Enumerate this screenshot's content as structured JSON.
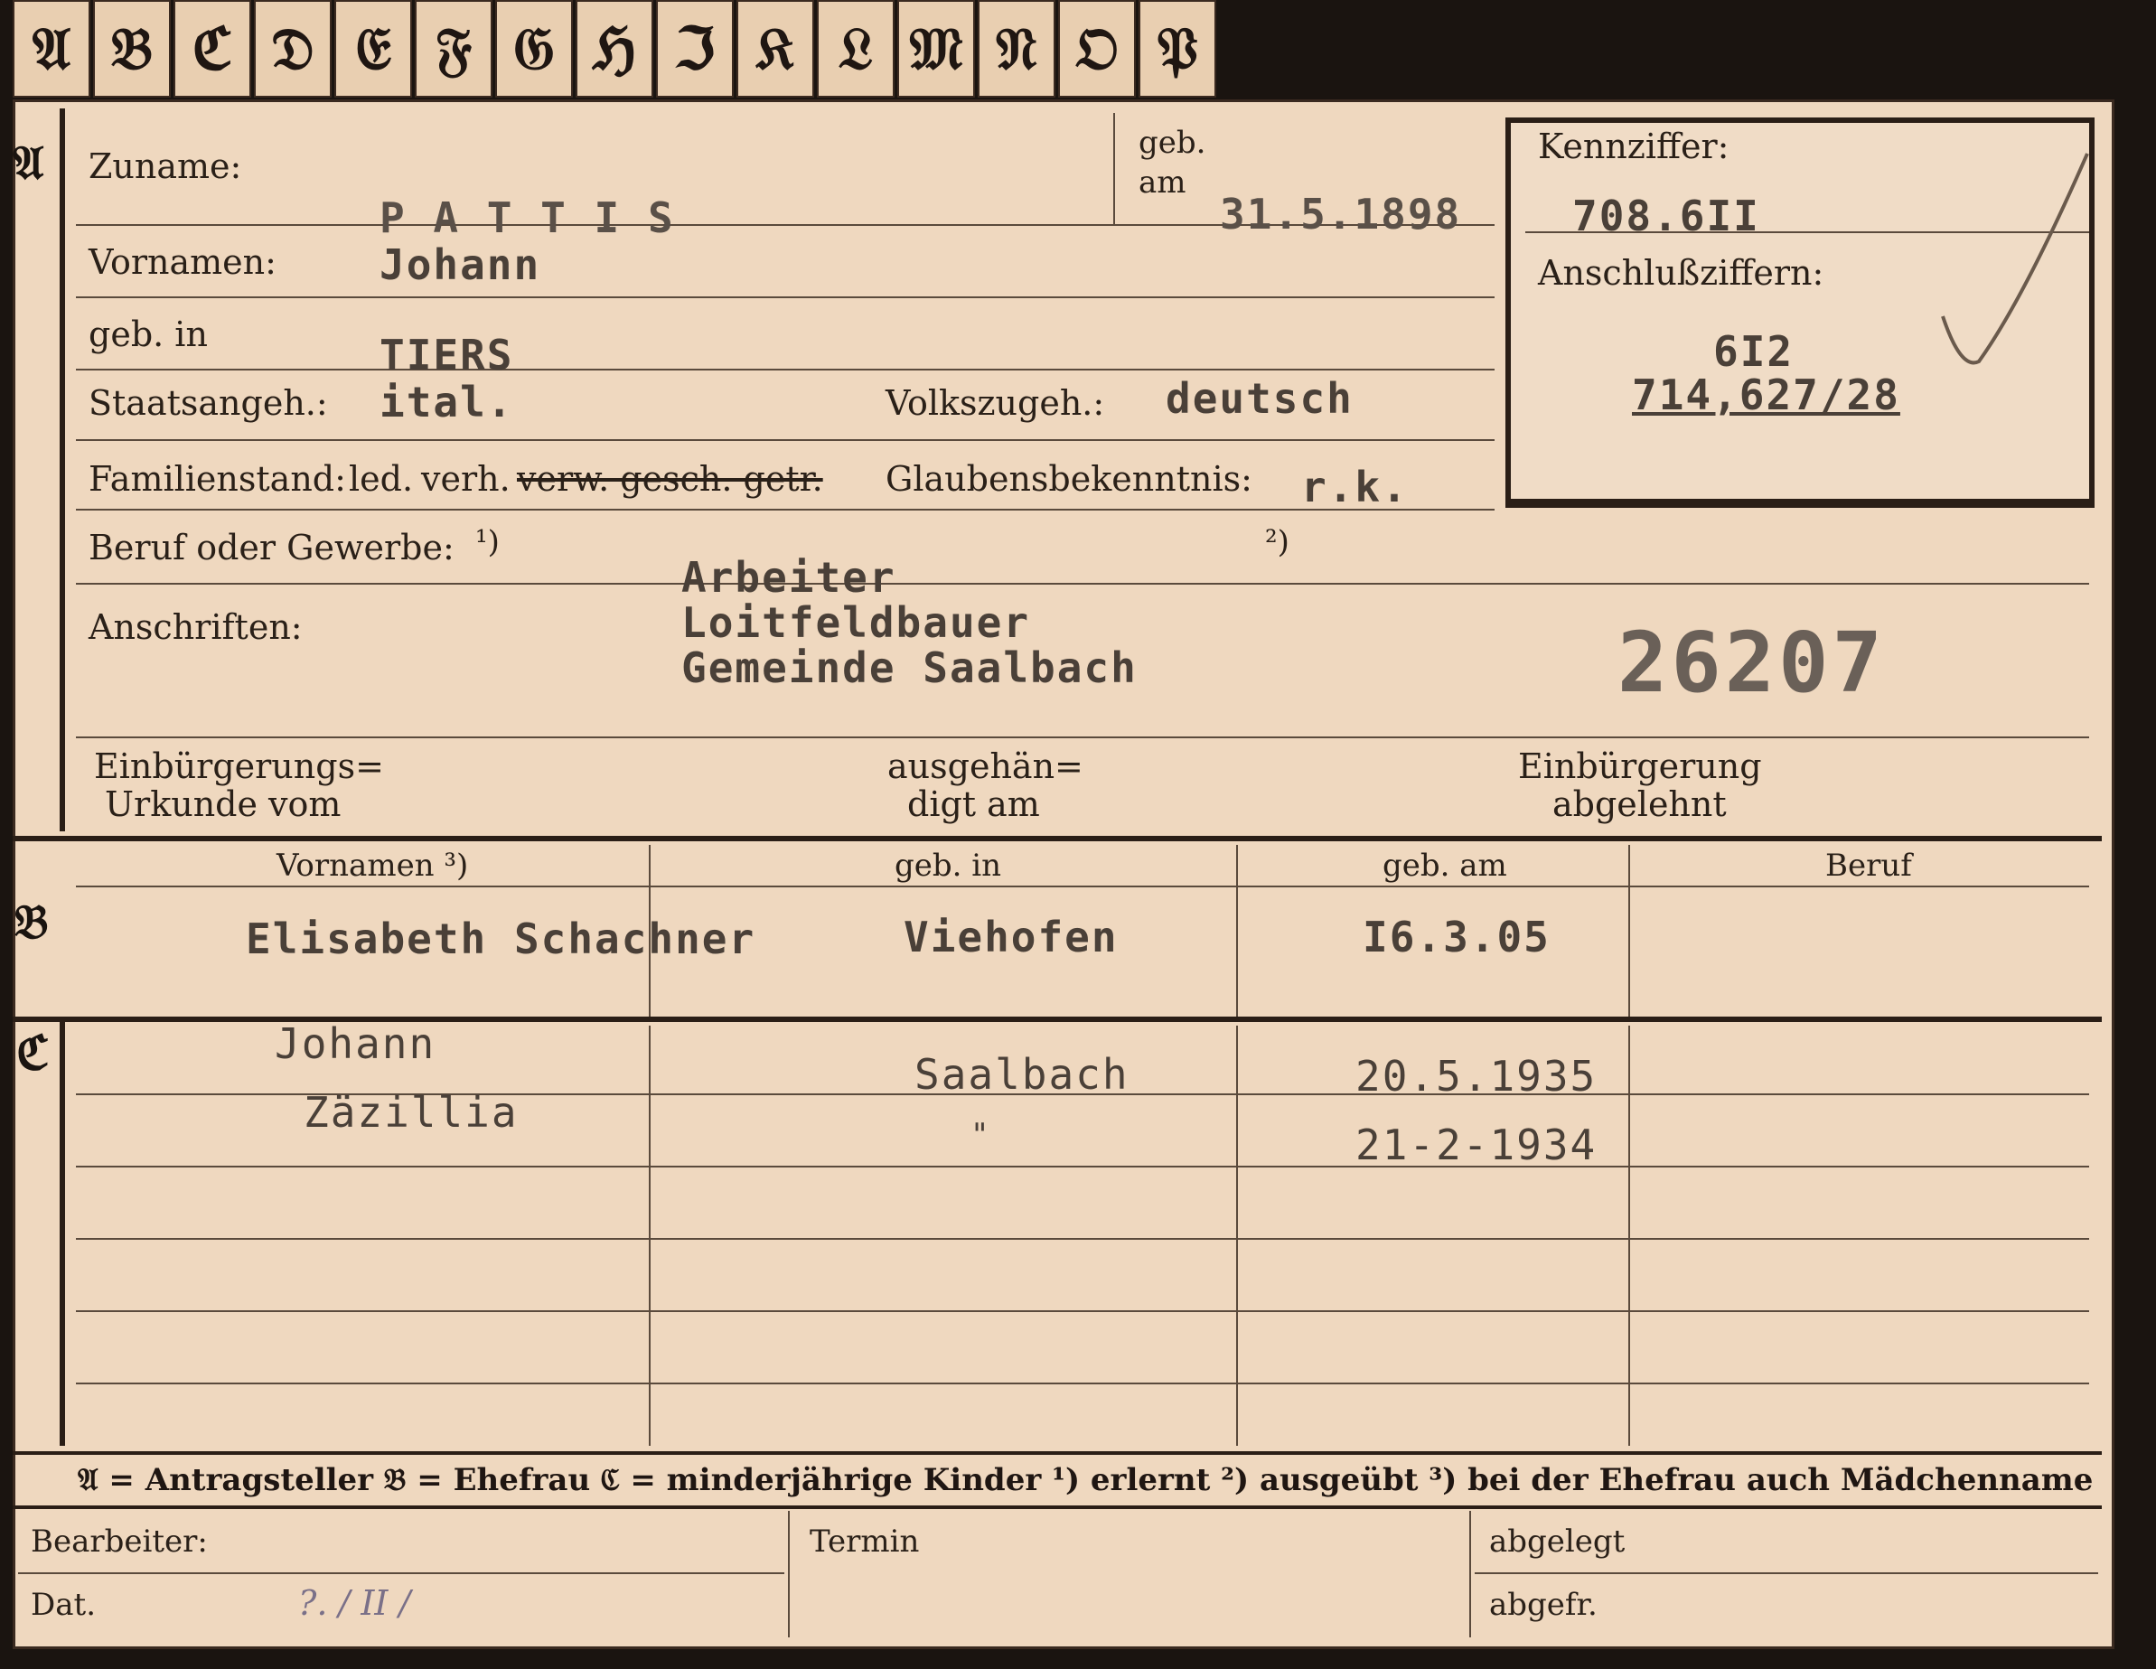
{
  "tabs": [
    "𝔄",
    "𝔅",
    "ℭ",
    "𝔇",
    "𝔈",
    "𝔉",
    "𝔊",
    "ℌ",
    "ℑ",
    "𝔎",
    "𝔏",
    "𝔐",
    "𝔑",
    "𝔒",
    "𝔓"
  ],
  "sections": {
    "a": "𝔄",
    "b": "𝔅",
    "c": "ℭ"
  },
  "applicant": {
    "surname_label": "Zuname:",
    "surname": "P A T T I S",
    "born_label_1": "geb.",
    "born_label_2": "am",
    "born_date": "31.5.1898",
    "firstnames_label": "Vornamen:",
    "firstnames": "Johann",
    "birthplace_label": "geb. in",
    "birthplace": "TIERS",
    "citizenship_label": "Staatsangeh.:",
    "citizenship": "ital.",
    "ethnicity_label": "Volkszugeh.:",
    "ethnicity": "deutsch",
    "marital_label": "Familienstand:",
    "marital_options_a": "led.",
    "marital_options_b": "verh.",
    "marital_options_c": "verw. gesch. getr.",
    "religion_label": "Glaubensbekenntnis:",
    "religion": "r.k.",
    "occupation_label": "Beruf oder Gewerbe:",
    "occupation_note1": "¹)",
    "occupation_note2": "²)",
    "occupation": "Arbeiter",
    "address_label": "Anschriften:",
    "address_line1": "Loitfeldbauer",
    "address_line2": "Gemeinde Saalbach",
    "number_stamp": "26207",
    "naturalization_label_1": "Einbürgerungs=",
    "naturalization_label_2": "Urkunde vom",
    "handed_label_1": "ausgehän=",
    "handed_label_2": "digt am",
    "refused_label_1": "Einbürgerung",
    "refused_label_2": "abgelehnt"
  },
  "reference": {
    "code_label": "Kennziffer:",
    "code": "708.6II",
    "linked_label": "Anschlußziffern:",
    "linked_1": "6I2",
    "linked_2": "714,627/28"
  },
  "wife": {
    "headers": [
      "Vornamen ³)",
      "geb. in",
      "geb. am",
      "Beruf"
    ],
    "name": "Elisabeth Schachner",
    "birthplace": "Viehofen",
    "born": "I6.3.05",
    "occupation": ""
  },
  "children": [
    {
      "name": "Johann",
      "birthplace": "Saalbach",
      "born": "20.5.1935"
    },
    {
      "name": "Zäzillia",
      "birthplace": "\"",
      "born": "21-2-1934"
    }
  ],
  "legend": "𝔄 = Antragsteller   𝔅 = Ehefrau   ℭ = minderjährige Kinder   ¹) erlernt   ²) ausgeübt   ³) bei der Ehefrau auch Mädchenname",
  "footer": {
    "editor_label": "Bearbeiter:",
    "date_label": "Dat.",
    "date_value": "?. / II   /",
    "deadline_label": "Termin",
    "filed_label": "abgelegt",
    "sent_label": "abgefr."
  }
}
